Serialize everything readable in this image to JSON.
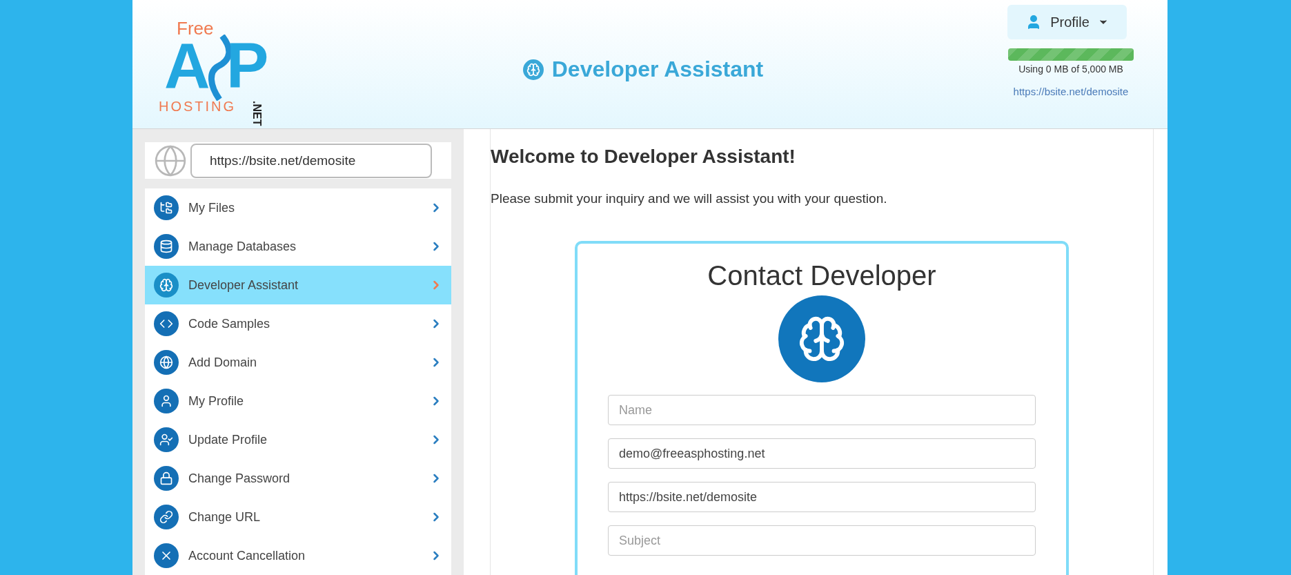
{
  "logo": {
    "top": "Free",
    "left_letter": "A",
    "right_letter": "P",
    "bottom": "HOSTING",
    "suffix": ".NET"
  },
  "header": {
    "title": "Developer Assistant",
    "profile_button": "Profile",
    "storage": {
      "level": 1,
      "reading": "Using 0 MB of 5,000 MB"
    },
    "site_link": "https://bsite.net/demosite"
  },
  "sidebar": {
    "site_url": "https://bsite.net/demosite",
    "items": [
      {
        "label": "My Files",
        "selected": false
      },
      {
        "label": "Manage Databases",
        "selected": false
      },
      {
        "label": "Developer Assistant",
        "selected": true
      },
      {
        "label": "Code Samples",
        "selected": false
      },
      {
        "label": "Add Domain",
        "selected": false
      },
      {
        "label": "My Profile",
        "selected": false
      },
      {
        "label": "Update Profile",
        "selected": false
      },
      {
        "label": "Change Password",
        "selected": false
      },
      {
        "label": "Change URL",
        "selected": false
      },
      {
        "label": "Account Cancellation",
        "selected": false
      }
    ]
  },
  "main": {
    "heading": "Welcome to Developer Assistant!",
    "intro": "Please submit your inquiry and we will assist you with your question.",
    "form": {
      "title": "Contact Developer",
      "fields": [
        {
          "placeholder": "Name"
        },
        {
          "value": "demo@freeasphosting.net"
        },
        {
          "value": "https://bsite.net/demosite"
        },
        {
          "placeholder": "Subject"
        }
      ]
    }
  }
}
